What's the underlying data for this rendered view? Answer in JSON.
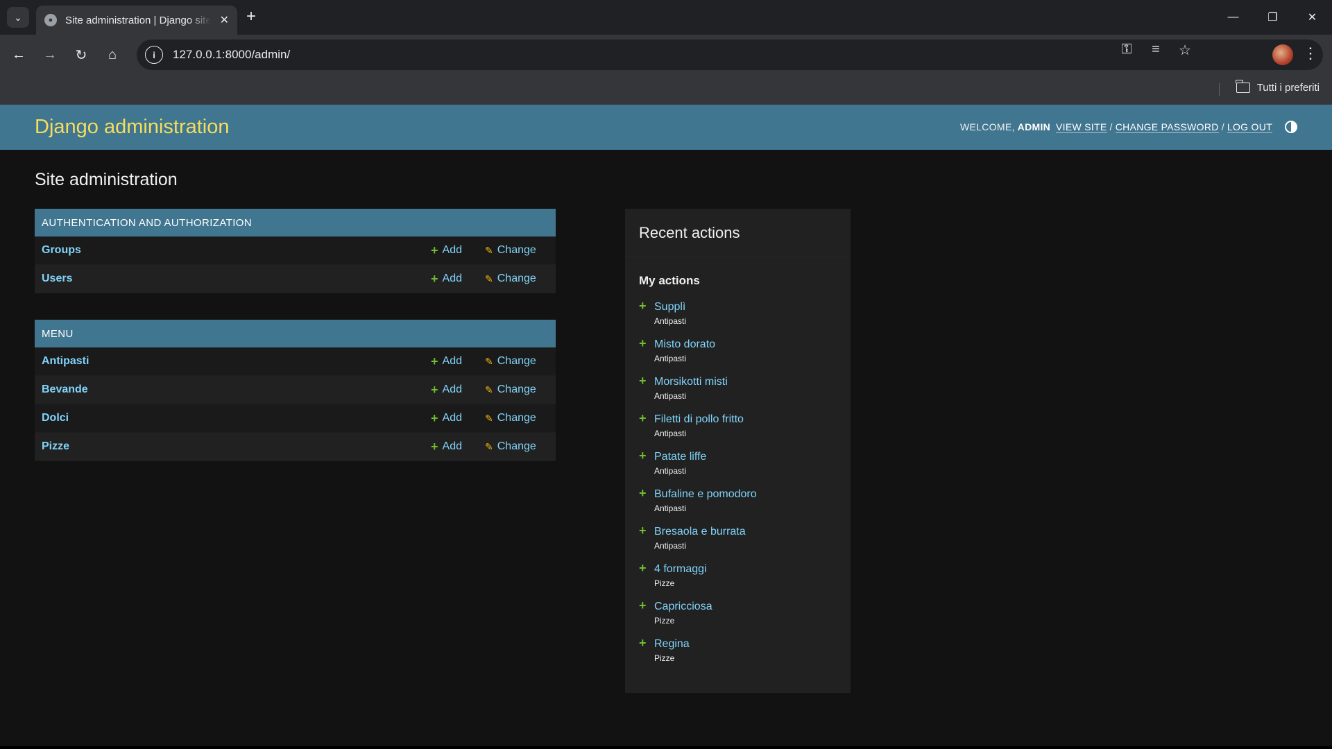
{
  "browser": {
    "tab_title": "Site administration | Django site admin",
    "url": "127.0.0.1:8000/admin/",
    "bookmarks_label": "Tutti i preferiti"
  },
  "header": {
    "branding": "Django administration",
    "welcome": "WELCOME,",
    "username": "ADMIN",
    "view_site": "VIEW SITE",
    "change_password": "CHANGE PASSWORD",
    "log_out": "LOG OUT",
    "separator": "/"
  },
  "page_title": "Site administration",
  "modules": [
    {
      "caption": "AUTHENTICATION AND AUTHORIZATION",
      "models": [
        {
          "name": "Groups",
          "add": "Add",
          "change": "Change"
        },
        {
          "name": "Users",
          "add": "Add",
          "change": "Change"
        }
      ]
    },
    {
      "caption": "MENU",
      "models": [
        {
          "name": "Antipasti",
          "add": "Add",
          "change": "Change"
        },
        {
          "name": "Bevande",
          "add": "Add",
          "change": "Change"
        },
        {
          "name": "Dolci",
          "add": "Add",
          "change": "Change"
        },
        {
          "name": "Pizze",
          "add": "Add",
          "change": "Change"
        }
      ]
    }
  ],
  "recent_actions": {
    "title": "Recent actions",
    "subtitle": "My actions",
    "items": [
      {
        "name": "Supplì",
        "category": "Antipasti"
      },
      {
        "name": "Misto dorato",
        "category": "Antipasti"
      },
      {
        "name": "Morsikotti misti",
        "category": "Antipasti"
      },
      {
        "name": "Filetti di pollo fritto",
        "category": "Antipasti"
      },
      {
        "name": "Patate liffe",
        "category": "Antipasti"
      },
      {
        "name": "Bufaline e pomodoro",
        "category": "Antipasti"
      },
      {
        "name": "Bresaola e burrata",
        "category": "Antipasti"
      },
      {
        "name": "4 formaggi",
        "category": "Pizze"
      },
      {
        "name": "Capricciosa",
        "category": "Pizze"
      },
      {
        "name": "Regina",
        "category": "Pizze"
      }
    ]
  },
  "colors": {
    "header_bg": "#417690",
    "branding": "#f5dd5d",
    "link": "#81d4fa",
    "add_icon": "#70bf2b",
    "change_icon": "#efb80b",
    "page_bg": "#121212"
  }
}
